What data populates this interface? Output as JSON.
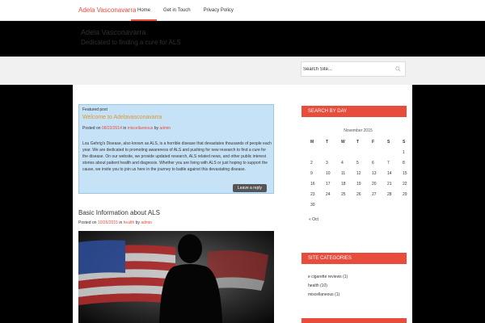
{
  "nav": {
    "logo_part1": "Adela Vas",
    "logo_part2": "conavarra",
    "items": [
      {
        "label": "Home"
      },
      {
        "label": "Get in Touch"
      },
      {
        "label": "Privacy Policy"
      }
    ]
  },
  "header": {
    "title": "Adela Vasconavarra",
    "tagline": "Dedicated to finding a cure for ALS"
  },
  "search": {
    "placeholder": "Search Site..."
  },
  "featured": {
    "tag": "Featured post",
    "title": "Welcome to Adelavasconavarra",
    "posted_on": "Posted on",
    "date": "08/22/2014",
    "in": "in",
    "category": "miscellaneous",
    "by": "by",
    "author": "admin",
    "body": "Lou Gehrig's Disease, also known as ALS, is a horrible disease that devastates thousands of people each year. We are dedicated to promoting awareness of ALS and pushing for new research to find a cure for the disease. On our website, we provide updated research, ALS related news, and other public interest stories about patient health and diagnosis. Whether you are living with ALS or just hoping to support the cause, we invite you to join us here in the journey to battle against this devastating disease.",
    "reply": "Leave a reply"
  },
  "post2": {
    "title": "Basic Information about ALS",
    "posted_on": "Posted on",
    "date": "10/26/2015",
    "in": "in",
    "category": "health",
    "by": "by",
    "author": "admin"
  },
  "sidebar": {
    "search_by_day": "SEARCH BY DAY",
    "calendar": {
      "month": "November 2015",
      "days": [
        "M",
        "T",
        "W",
        "T",
        "F",
        "S",
        "S"
      ],
      "weeks": [
        [
          "",
          "",
          "",
          "",
          "",
          "",
          "1"
        ],
        [
          "2",
          "3",
          "4",
          "5",
          "6",
          "7",
          "8"
        ],
        [
          "9",
          "10",
          "11",
          "12",
          "13",
          "14",
          "15"
        ],
        [
          "16",
          "17",
          "18",
          "19",
          "20",
          "21",
          "22"
        ],
        [
          "23",
          "24",
          "25",
          "26",
          "27",
          "28",
          "29"
        ],
        [
          "30",
          "",
          "",
          "",
          "",
          "",
          ""
        ]
      ],
      "prev": "« Oct"
    },
    "site_categories": "SITE CATEGORIES",
    "categories": [
      {
        "name": "e cigarette reviews",
        "count": "(1)"
      },
      {
        "name": "health",
        "count": "(10)"
      },
      {
        "name": "miscellaneous",
        "count": "(1)"
      }
    ]
  },
  "colors": {
    "accent": "#e74c3c",
    "featured_bg": "#c6e2f6",
    "featured_title": "#e0962a"
  }
}
